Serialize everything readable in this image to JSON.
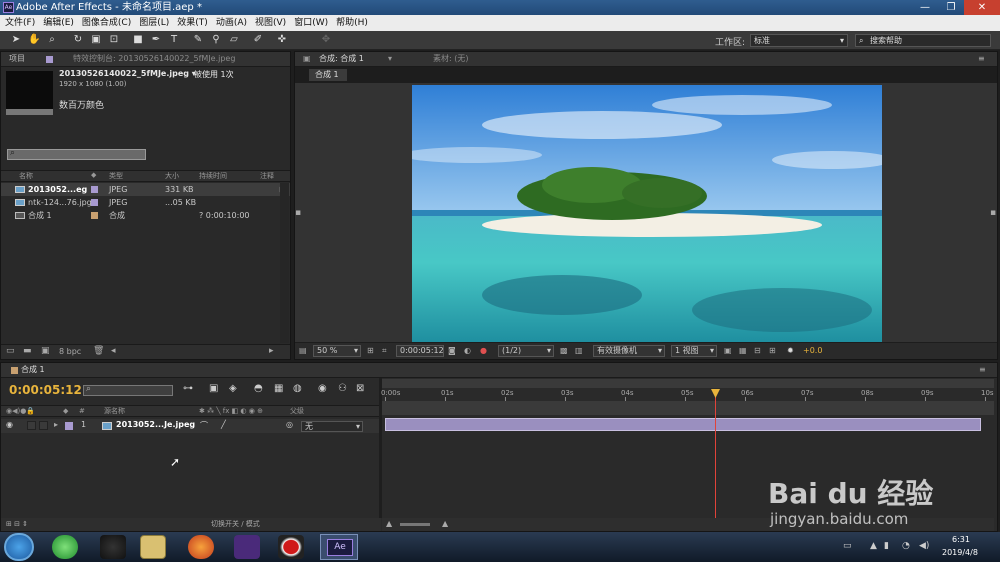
{
  "window": {
    "title": "Adobe After Effects - 未命名项目.aep *",
    "logo": "Ae"
  },
  "menu": [
    "文件(F)",
    "编辑(E)",
    "图像合成(C)",
    "图层(L)",
    "效果(T)",
    "动画(A)",
    "视图(V)",
    "窗口(W)",
    "帮助(H)"
  ],
  "toolbar": {
    "workspace_label": "工作区:",
    "workspace_value": "标准",
    "help_placeholder": "搜索帮助"
  },
  "project": {
    "tab": "项目",
    "effects_tab": "特效控制台: 20130526140022_5fMJe.jpeg",
    "file_name": "20130526140022_5fMJe.jpeg ▾",
    "used": "被使用 1次",
    "dimensions": "1920 x 1080 (1.00)",
    "color": "数百万颜色",
    "columns": [
      "名称",
      "类型",
      "大小",
      "持续时间",
      "注释"
    ],
    "items": [
      {
        "name": "2013052...eg",
        "type": "JPEG",
        "size": "331 KB",
        "duration": "",
        "color": "#a89ad0"
      },
      {
        "name": "ntk-124...76.jpg",
        "type": "JPEG",
        "size": "...05 KB",
        "duration": "",
        "color": "#a89ad0"
      },
      {
        "name": "合成 1",
        "type": "合成",
        "size": "",
        "duration": "? 0:00:10:00",
        "color": "#c8a070"
      }
    ],
    "bpc": "8 bpc"
  },
  "viewer": {
    "tab": "合成: 合成 1",
    "footage_tab": "素材: (无)",
    "sub_tab": "合成 1",
    "zoom": "50 %",
    "timecode": "0:00:05:12",
    "resolution": "(1/2)",
    "camera": "有效摄像机",
    "views": "1 视图",
    "exposure": "+0.0"
  },
  "timeline": {
    "tab": "合成 1",
    "timecode": "0:00:05:12",
    "switch_label": "切换开关 / 模式",
    "col_source": "源名称",
    "col_parent": "父级",
    "layer": {
      "index": "1",
      "name": "2013052...Je.jpeg",
      "parent": "无"
    },
    "ruler": [
      "0:00s",
      "01s",
      "02s",
      "03s",
      "04s",
      "05s",
      "06s",
      "07s",
      "08s",
      "09s",
      "10s"
    ],
    "playhead_fraction": 0.55
  },
  "taskbar": {
    "time": "6:31",
    "date": "2019/4/8"
  },
  "watermark": {
    "brand": "Bai du 经验",
    "url": "jingyan.baidu.com"
  },
  "colors": {
    "timecode": "#e8b43c",
    "playhead": "#e0433a",
    "layer_bar": "#9a8fbf"
  }
}
